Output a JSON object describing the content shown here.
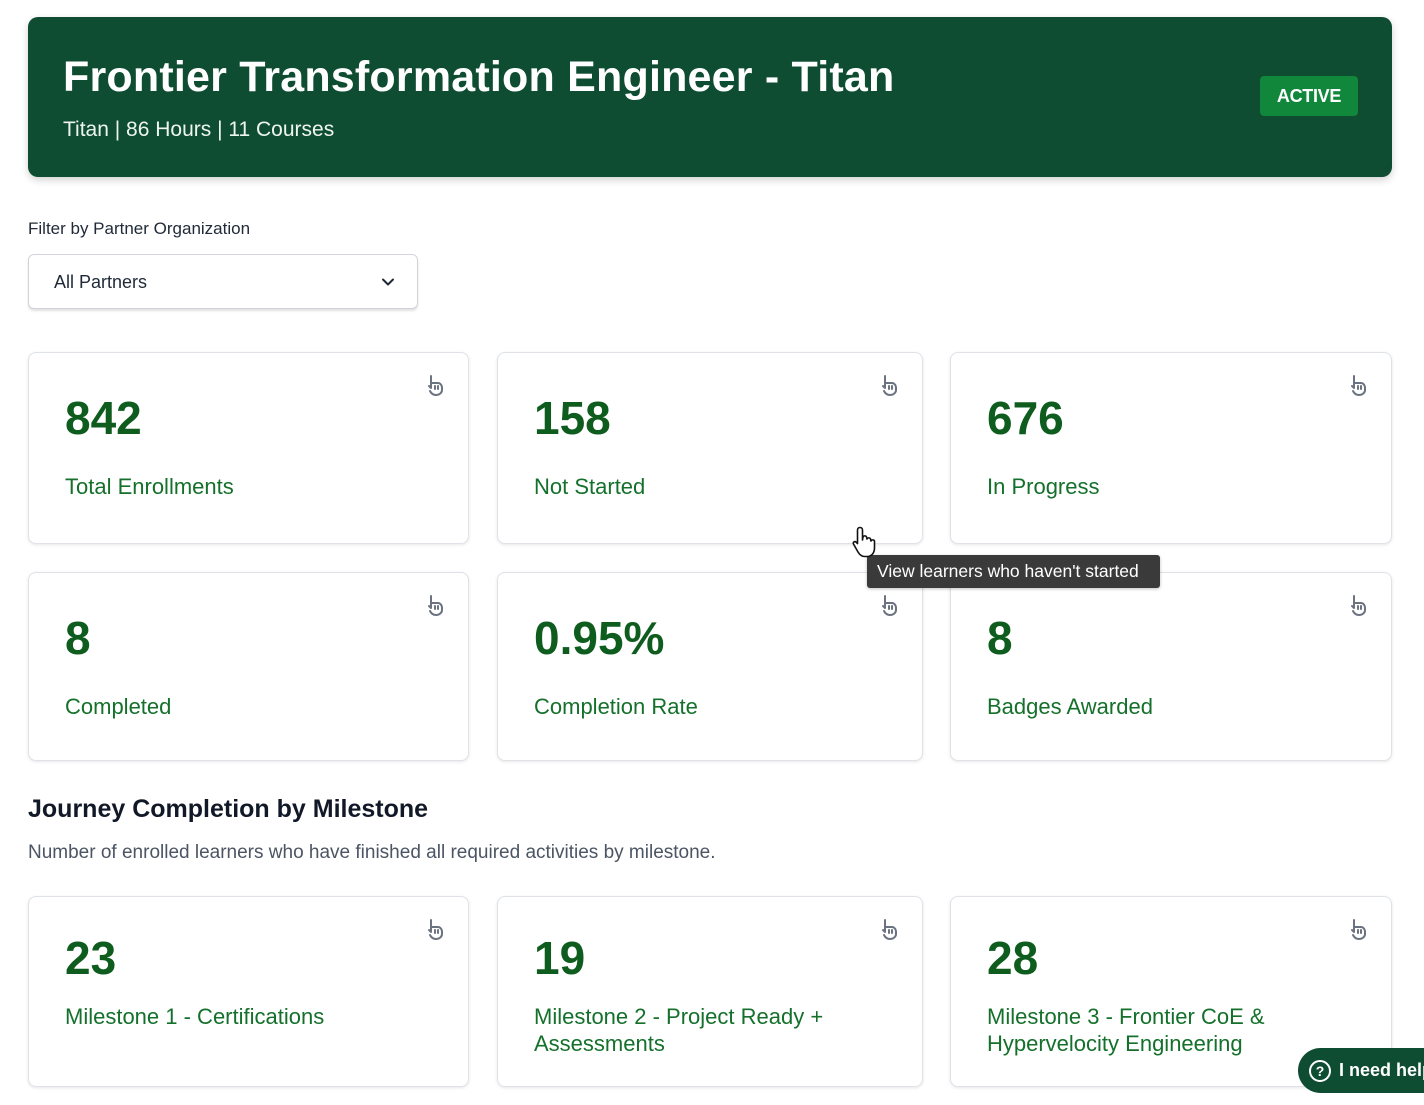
{
  "header": {
    "title": "Frontier Transformation Engineer - Titan",
    "subtitle": "Titan | 86 Hours | 11 Courses",
    "status": "ACTIVE"
  },
  "filter": {
    "label": "Filter by Partner Organization",
    "selected": "All Partners"
  },
  "stats": [
    {
      "value": "842",
      "label": "Total Enrollments"
    },
    {
      "value": "158",
      "label": "Not Started"
    },
    {
      "value": "676",
      "label": "In Progress"
    },
    {
      "value": "8",
      "label": "Completed"
    },
    {
      "value": "0.95%",
      "label": "Completion Rate"
    },
    {
      "value": "8",
      "label": "Badges Awarded"
    }
  ],
  "section": {
    "title": "Journey Completion by Milestone",
    "subtitle": "Number of enrolled learners who have finished all required activities by milestone."
  },
  "milestones": [
    {
      "value": "23",
      "label": "Milestone 1 - Certifications"
    },
    {
      "value": "19",
      "label": "Milestone 2 - Project Ready + Assessments"
    },
    {
      "value": "28",
      "label": "Milestone 3 - Frontier CoE & Hypervelocity Engineering"
    }
  ],
  "tooltip": {
    "text": "View learners who haven't started"
  },
  "help": {
    "label": "I need help",
    "icon": "?"
  },
  "icons": {
    "card_icon": "tap-pointer-icon"
  },
  "colors": {
    "brand": "#0f4d33",
    "badge": "#11873b",
    "stat_value": "#0f5c1f"
  }
}
